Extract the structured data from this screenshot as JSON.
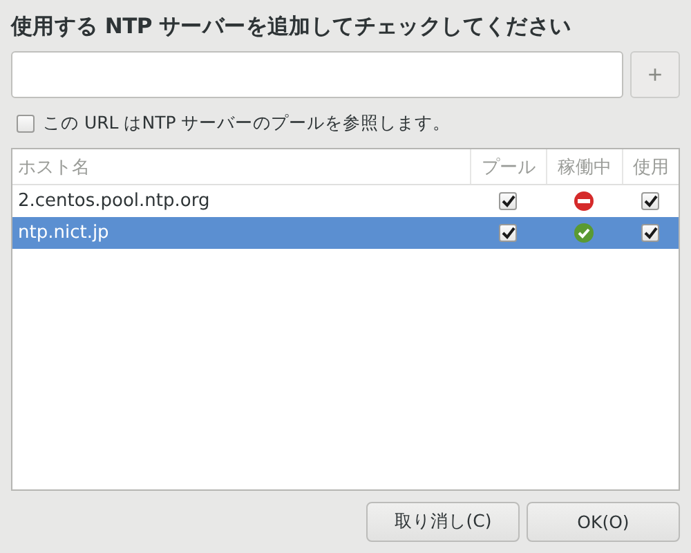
{
  "title": "使用する NTP サーバーを追加してチェックしてください",
  "new_server": {
    "add_button": "+"
  },
  "pool_checkbox": {
    "label": "この URL はNTP サーバーのプールを参照します。",
    "checked": false
  },
  "table": {
    "columns": [
      "ホスト名",
      "プール",
      "稼働中",
      "使用"
    ],
    "rows": [
      {
        "host": "2.centos.pool.ntp.org",
        "pool": true,
        "running": false,
        "use": true,
        "selected": false
      },
      {
        "host": "ntp.nict.jp",
        "pool": true,
        "running": true,
        "use": true,
        "selected": true
      }
    ]
  },
  "buttons": [
    {
      "label": "取り消し(C)"
    },
    {
      "label": "OK(O)"
    }
  ]
}
